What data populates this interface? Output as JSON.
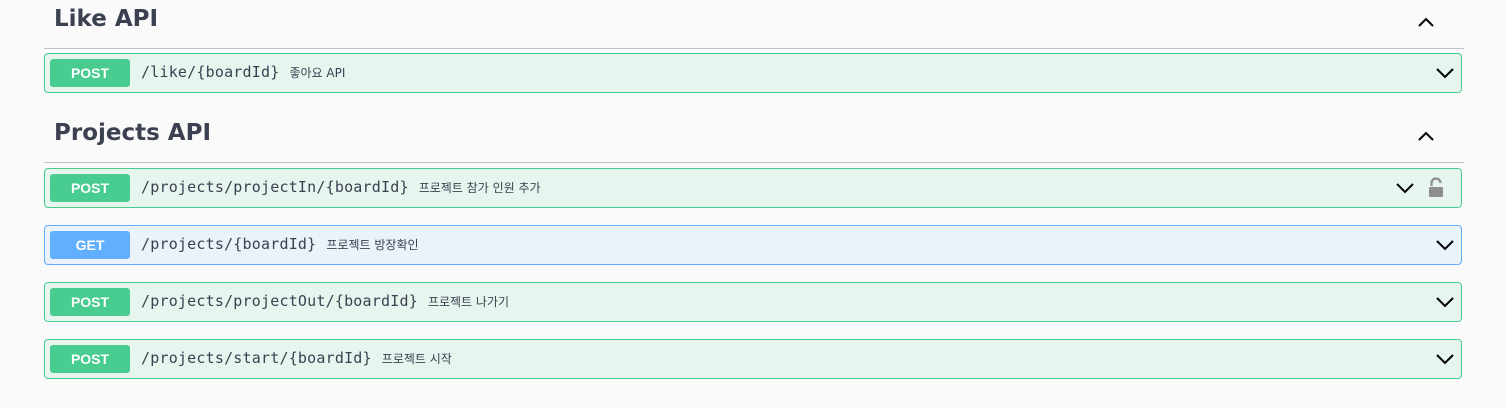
{
  "sections": [
    {
      "title": "Like API",
      "operations": [
        {
          "method": "POST",
          "path": "/like/{boardId}",
          "summary": "좋아요 API"
        }
      ]
    },
    {
      "title": "Projects API",
      "operations": [
        {
          "method": "POST",
          "path": "/projects/projectIn/{boardId}",
          "summary": "프로젝트 참가 인원 추가",
          "locked": true
        },
        {
          "method": "GET",
          "path": "/projects/{boardId}",
          "summary": "프로젝트 방장확인"
        },
        {
          "method": "POST",
          "path": "/projects/projectOut/{boardId}",
          "summary": "프로젝트 나가기"
        },
        {
          "method": "POST",
          "path": "/projects/start/{boardId}",
          "summary": "프로젝트 시작"
        }
      ]
    }
  ],
  "colors": {
    "post": "#49cc90",
    "get": "#61affe",
    "text": "#3b4151"
  },
  "icons": {
    "collapse": "chevron-up-icon",
    "expand": "chevron-down-icon",
    "auth": "unlocked-padlock-icon"
  }
}
